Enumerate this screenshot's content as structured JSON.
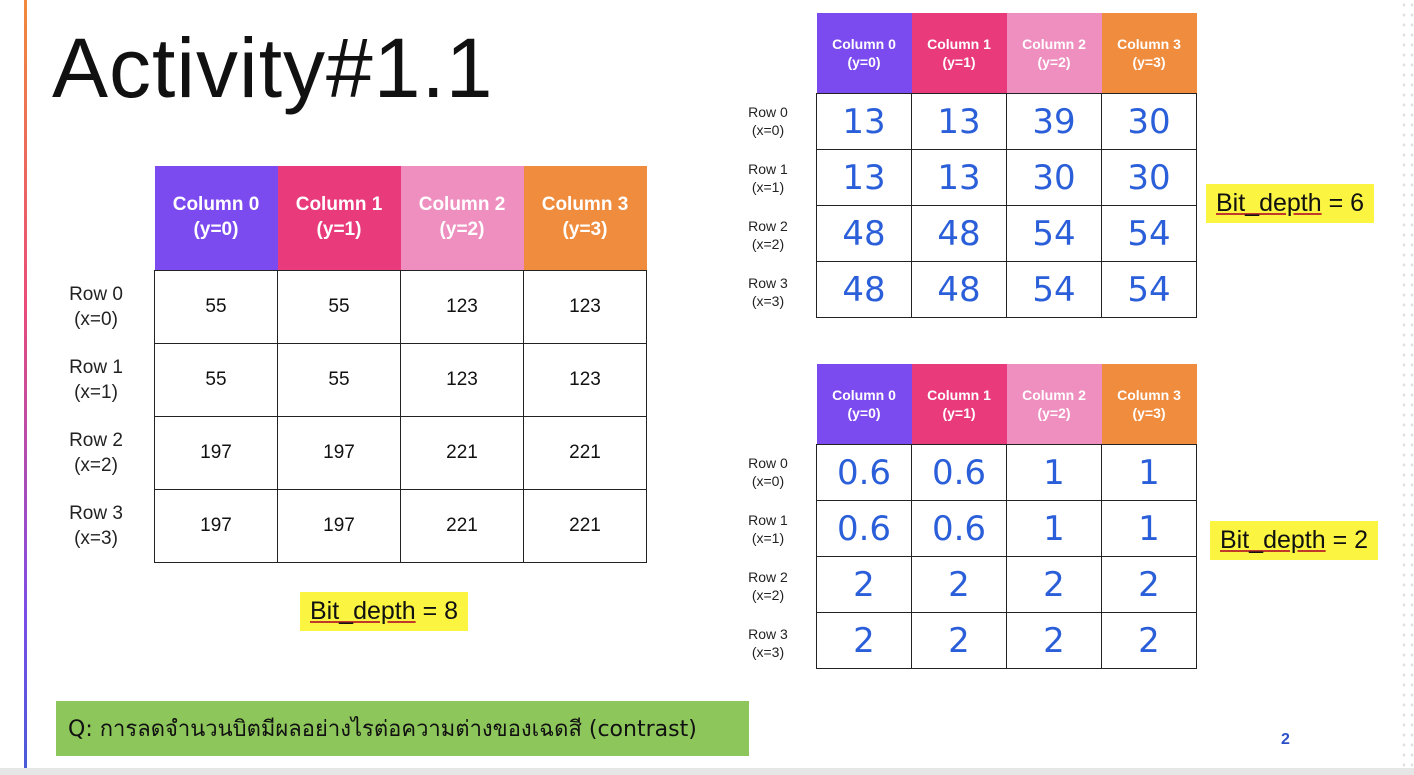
{
  "title": "Activity#1.1",
  "column_headers": [
    {
      "name": "Column 0",
      "sub": "(y=0)"
    },
    {
      "name": "Column 1",
      "sub": "(y=1)"
    },
    {
      "name": "Column 2",
      "sub": "(y=2)"
    },
    {
      "name": "Column 3",
      "sub": "(y=3)"
    }
  ],
  "row_headers": [
    {
      "name": "Row 0",
      "sub": "(x=0)"
    },
    {
      "name": "Row 1",
      "sub": "(x=1)"
    },
    {
      "name": "Row 2",
      "sub": "(x=2)"
    },
    {
      "name": "Row 3",
      "sub": "(x=3)"
    }
  ],
  "header_colors": [
    "#7c4bf0",
    "#e93b7c",
    "#ee8fbf",
    "#f08c3e"
  ],
  "tables": {
    "bit8": {
      "label": "Bit_depth",
      "suffix": " = 8",
      "cells": [
        [
          "55",
          "55",
          "123",
          "123"
        ],
        [
          "55",
          "55",
          "123",
          "123"
        ],
        [
          "197",
          "197",
          "221",
          "221"
        ],
        [
          "197",
          "197",
          "221",
          "221"
        ]
      ]
    },
    "bit6": {
      "label": "Bit_depth",
      "suffix": " = 6",
      "cells": [
        [
          "13",
          "13",
          "39",
          "30"
        ],
        [
          "13",
          "13",
          "30",
          "30"
        ],
        [
          "48",
          "48",
          "54",
          "54"
        ],
        [
          "48",
          "48",
          "54",
          "54"
        ]
      ]
    },
    "bit2": {
      "label": "Bit_depth",
      "suffix": " = 2",
      "cells": [
        [
          "0.6",
          "0.6",
          "1",
          "1"
        ],
        [
          "0.6",
          "0.6",
          "1",
          "1"
        ],
        [
          "2",
          "2",
          "2",
          "2"
        ],
        [
          "2",
          "2",
          "2",
          "2"
        ]
      ]
    }
  },
  "question": "Q: การลดจำนวนบิตมีผลอย่างไรต่อความต่างของเฉดสี (contrast)",
  "page_number": "2"
}
